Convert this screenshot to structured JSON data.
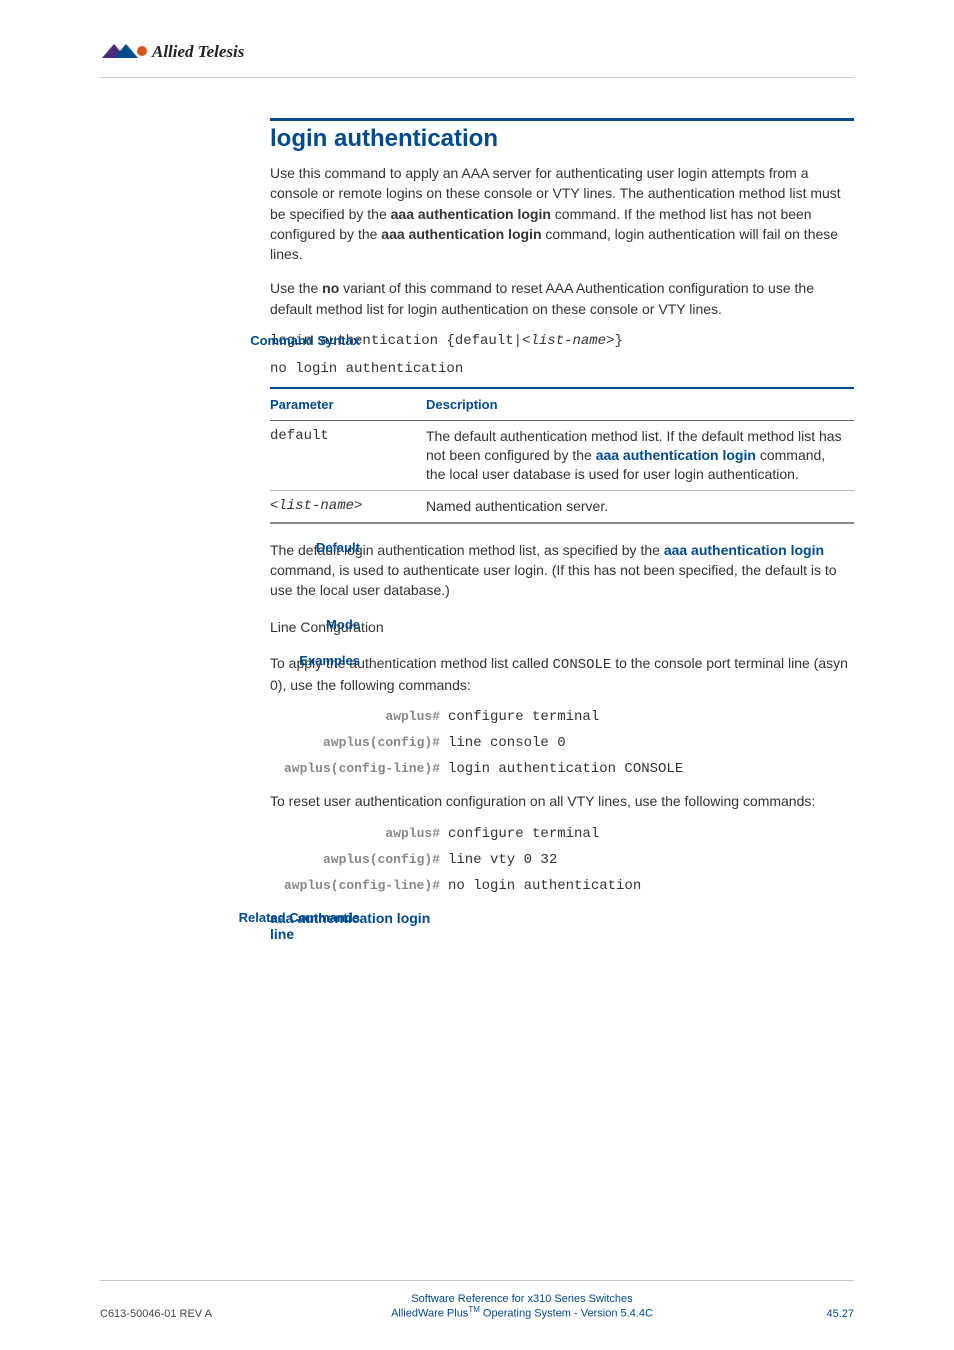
{
  "logo_text": "Allied Telesis",
  "title": "login authentication",
  "intro_p1_a": "Use this command to apply an AAA server for authenticating user login attempts from a console or remote logins on these console or VTY lines. The authentication method list must be specified by the ",
  "intro_p1_bold1": "aaa authentication login",
  "intro_p1_b": " command. If the method list has not been configured by the ",
  "intro_p1_bold2": "aaa authentication login",
  "intro_p1_c": " command, login authentication will fail on these lines.",
  "intro_p2_a": "Use the ",
  "intro_p2_bold": "no",
  "intro_p2_b": " variant of this command to reset AAA Authentication configuration to use the default method list for login authentication on these console or VTY lines.",
  "labels": {
    "syntax": "Command Syntax",
    "default": "Default",
    "mode": "Mode",
    "examples": "Examples",
    "related": "Related Commands"
  },
  "syntax_line1": "login authentication {default|<list-name>}",
  "syntax_line2": "no login authentication",
  "table": {
    "h1": "Parameter",
    "h2": "Description",
    "rows": [
      {
        "param": "default",
        "desc_a": "The default authentication method list. If the default method list has not been configured by the ",
        "desc_link": "aaa authentication login",
        "desc_b": " command, the local user database is used for user login authentication."
      },
      {
        "param": "<list-name>",
        "desc_a": "Named authentication server.",
        "desc_link": "",
        "desc_b": ""
      }
    ]
  },
  "default_text_a": "The default login authentication method list, as specified by the ",
  "default_link": "aaa authentication login",
  "default_text_b": " command, is used to authenticate user login. (If this has not been specified, the default is to use the local user database.)",
  "mode_text": "Line Configuration",
  "examples_intro_a": "To apply the authentication method list called ",
  "examples_intro_mono": "CONSOLE",
  "examples_intro_b": " to the console port terminal line (asyn 0), use the following commands:",
  "cmds1": [
    {
      "prompt": "awplus#",
      "text": "configure terminal"
    },
    {
      "prompt": "awplus(config)#",
      "text": "line console 0"
    },
    {
      "prompt": "awplus(config-line)#",
      "text": "login authentication CONSOLE"
    }
  ],
  "examples_intro2": "To reset user authentication configuration on all VTY lines, use the following commands:",
  "cmds2": [
    {
      "prompt": "awplus#",
      "text": "configure terminal"
    },
    {
      "prompt": "awplus(config)#",
      "text": "line vty 0 32"
    },
    {
      "prompt": "awplus(config-line)#",
      "text": "no login authentication"
    }
  ],
  "related": {
    "link1": "aaa authentication login",
    "link2": "line"
  },
  "footer": {
    "left": "C613-50046-01 REV A",
    "center1": "Software Reference for x310 Series Switches",
    "center2_a": "AlliedWare Plus",
    "center2_tm": "TM",
    "center2_b": " Operating System - Version 5.4.4C",
    "right": "45.27"
  }
}
